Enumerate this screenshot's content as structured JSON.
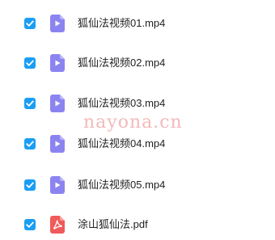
{
  "files": [
    {
      "name": "狐仙法视频01.mp4",
      "checked": true,
      "icon": "video-file-icon"
    },
    {
      "name": "狐仙法视频02.mp4",
      "checked": true,
      "icon": "video-file-icon"
    },
    {
      "name": "狐仙法视频03.mp4",
      "checked": true,
      "icon": "video-file-icon"
    },
    {
      "name": "狐仙法视频04.mp4",
      "checked": true,
      "icon": "video-file-icon"
    },
    {
      "name": "狐仙法视频05.mp4",
      "checked": true,
      "icon": "video-file-icon"
    },
    {
      "name": "涂山狐仙法.pdf",
      "checked": true,
      "icon": "pdf-file-icon"
    }
  ],
  "watermark": {
    "text": "nayona.cn"
  },
  "colors": {
    "checkbox": "#1a9ef5",
    "video_icon": "#8b84f0",
    "pdf_icon": "#f05a5a",
    "watermark": "#f3b9b9"
  }
}
